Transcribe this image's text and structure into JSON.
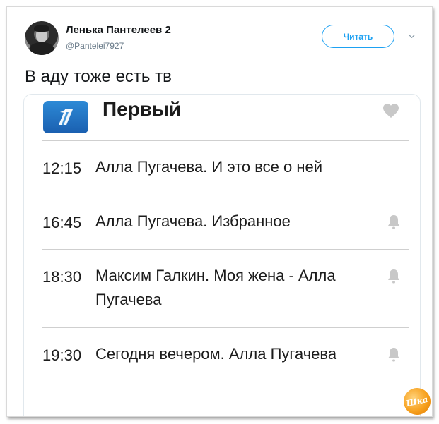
{
  "tweet": {
    "author_name": "Ленька Пантелеев 2",
    "author_handle": "@Pantelei7927",
    "follow_label": "Читать",
    "text": "В аду тоже есть тв"
  },
  "tv_card": {
    "channel_name": "Первый",
    "programs": [
      {
        "time": "12:15",
        "title": "Алла Пугачева. И это все о ней",
        "reminder_icon": false
      },
      {
        "time": "16:45",
        "title": "Алла Пугачева. Избранное",
        "reminder_icon": true
      },
      {
        "time": "18:30",
        "title": "Максим Галкин. Моя жена - Алла Пугачева",
        "reminder_icon": true
      },
      {
        "time": "19:30",
        "title": "Сегодня вечером. Алла Пугачева",
        "reminder_icon": true
      }
    ]
  },
  "watermark": {
    "text": "Шка"
  },
  "colors": {
    "accent": "#1da1f2",
    "logo_blue": "#1f6fc4",
    "icon_gray": "#c8c8c8"
  },
  "icons": [
    "chevron-down-icon",
    "heart-icon",
    "bell-icon",
    "channel-one-logo"
  ]
}
